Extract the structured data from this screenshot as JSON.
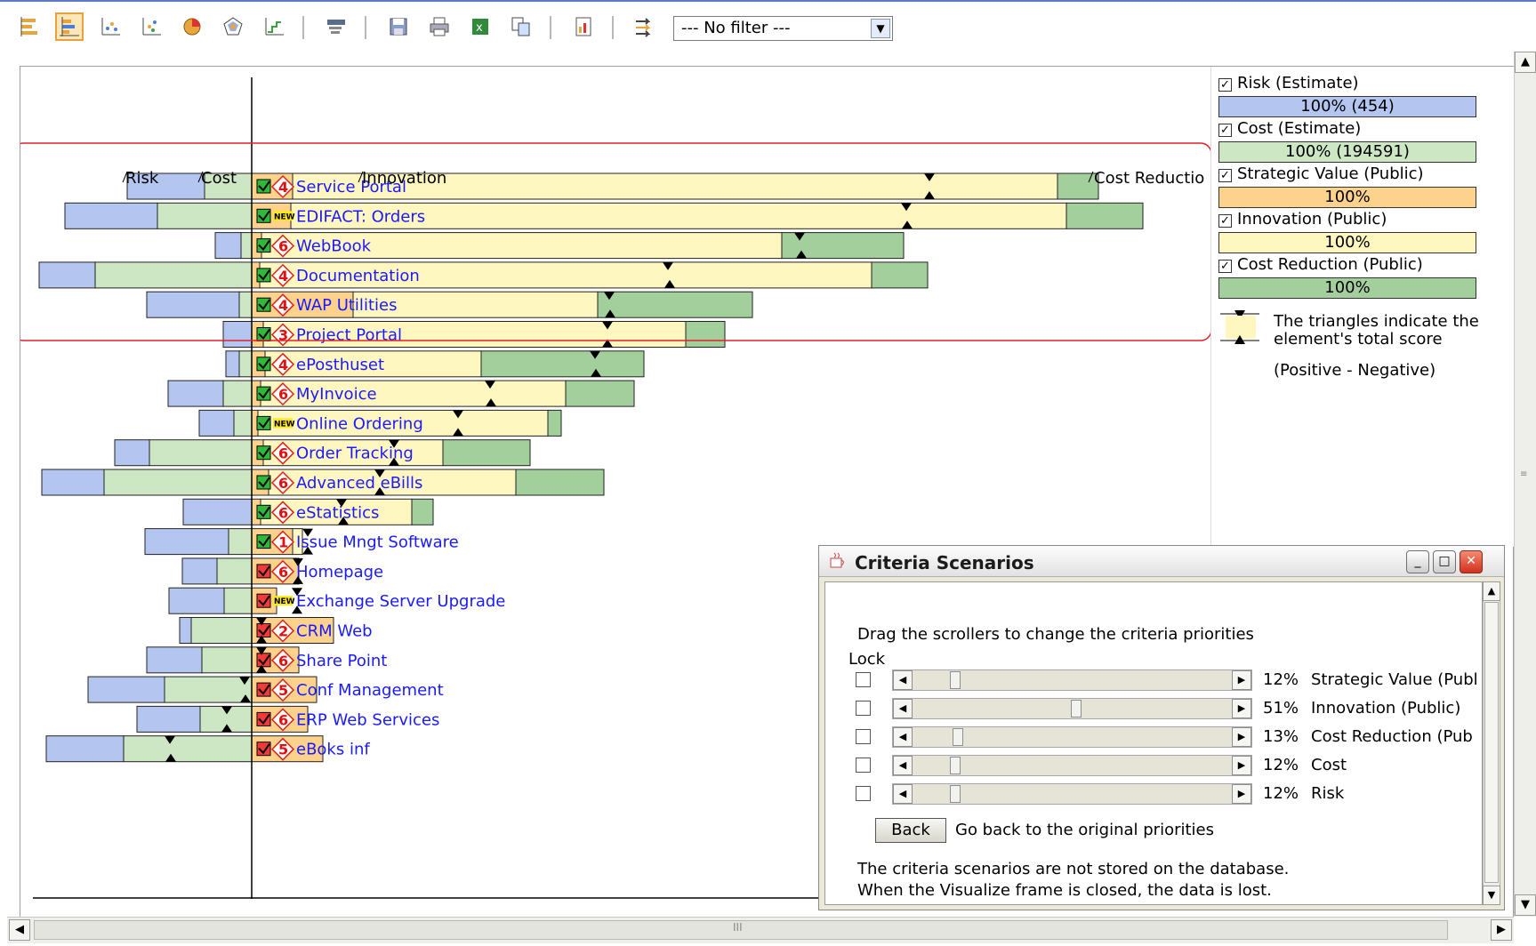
{
  "toolbar": {
    "filter_value": "--- No filter ---",
    "buttons": [
      "gantt-view-icon",
      "bar-view-icon",
      "scatter-view-icon",
      "scatter-alt-icon",
      "pie-view-icon",
      "radar-view-icon",
      "step-chart-icon",
      "filter-settings-icon",
      "save-icon",
      "print-icon",
      "export-excel-icon",
      "copy-icon",
      "report-icon",
      "scenarios-icon"
    ]
  },
  "chart": {
    "column_labels": {
      "risk": "Risk",
      "cost": "Cost",
      "innovation": "Innovation",
      "cost_reduction": "Cost Reductio"
    },
    "colors": {
      "risk": "#b4c6f0",
      "cost": "#cde6c4",
      "strategic": "#fdd28c",
      "innovation": "#fff6c0",
      "cost_reduction": "#a3cf9d",
      "highlight": "#e0202a",
      "link": "#1a1aff",
      "axis": "#000000"
    }
  },
  "chart_data": {
    "type": "bar",
    "categories": [
      "Service Portal",
      "EDIFACT: Orders",
      "WebBook",
      "Documentation",
      "WAP Utilities",
      "Project Portal",
      "ePosthuset",
      "MyInvoice",
      "Online Ordering",
      "Order Tracking",
      "Advanced eBills",
      "eStatistics",
      "Issue Mngt Software",
      "Homepage",
      "Exchange Server Upgrade",
      "CRM Web",
      "Share Point",
      "Conf Management",
      "ERP Web Services",
      "eBoks inf"
    ],
    "badges": [
      "4",
      "NEW",
      "6",
      "4",
      "4",
      "3",
      "4",
      "6",
      "NEW",
      "6",
      "6",
      "6",
      "1",
      "6",
      "NEW",
      "2",
      "6",
      "5",
      "6",
      "5"
    ],
    "status": [
      "green",
      "green",
      "green",
      "green",
      "green",
      "green",
      "green",
      "green",
      "green",
      "green",
      "green",
      "green",
      "green",
      "red",
      "red",
      "red",
      "red",
      "red",
      "red",
      "red"
    ],
    "series": [
      {
        "name": "Risk",
        "values": [
          87,
          104,
          29,
          63,
          104,
          32,
          15,
          62,
          39,
          39,
          70,
          77,
          94,
          39,
          62,
          13,
          62,
          86,
          71,
          87
        ]
      },
      {
        "name": "Cost",
        "values": [
          53,
          106,
          12,
          176,
          14,
          0,
          14,
          32,
          20,
          115,
          166,
          0,
          26,
          39,
          31,
          68,
          56,
          98,
          58,
          144
        ]
      },
      {
        "name": "Strategic Value",
        "values": [
          46,
          44,
          11,
          9,
          114,
          13,
          15,
          10,
          7,
          13,
          19,
          10,
          46,
          53,
          28,
          92,
          53,
          73,
          63,
          80
        ]
      },
      {
        "name": "Innovation",
        "values": [
          860,
          872,
          585,
          688,
          275,
          475,
          243,
          343,
          326,
          202,
          278,
          170,
          11,
          0,
          0,
          0,
          0,
          0,
          0,
          0
        ]
      },
      {
        "name": "Cost Reduction",
        "values": [
          46,
          86,
          137,
          63,
          174,
          44,
          183,
          77,
          15,
          98,
          99,
          24,
          0,
          0,
          0,
          0,
          0,
          0,
          0,
          0
        ]
      }
    ],
    "score_negative": [
      1022,
      996,
      876,
      728,
      662,
      660,
      646,
      528,
      492,
      420,
      404,
      361,
      323,
      312,
      311,
      271,
      271,
      252,
      232,
      168
    ],
    "score_positive": [
      1022,
      997,
      878,
      730,
      663,
      660,
      647,
      529,
      492,
      420,
      404,
      363,
      323,
      312,
      311,
      271,
      271,
      253,
      232,
      169
    ]
  },
  "legend": {
    "items": [
      {
        "label": "Risk (Estimate)",
        "bar": "100% (454)",
        "color": "#b4c6f0"
      },
      {
        "label": "Cost (Estimate)",
        "bar": "100% (194591)",
        "color": "#cde6c4"
      },
      {
        "label": "Strategic Value (Public)",
        "bar": "100%",
        "color": "#fdd28c"
      },
      {
        "label": "Innovation (Public)",
        "bar": "100%",
        "color": "#fff6c0"
      },
      {
        "label": "Cost Reduction (Public)",
        "bar": "100%",
        "color": "#a3cf9d"
      }
    ],
    "triangle_note_1": "The triangles indicate the",
    "triangle_note_2": "element's total score",
    "triangle_note_3": "(Positive - Negative)"
  },
  "dialog": {
    "title": "Criteria Scenarios",
    "instruction": "Drag the scrollers to change the criteria priorities",
    "lock_label": "Lock",
    "criteria": [
      {
        "percent": "12%",
        "label": "Strategic Value (Publ",
        "value": 0.12
      },
      {
        "percent": "51%",
        "label": "Innovation (Public)",
        "value": 0.51
      },
      {
        "percent": "13%",
        "label": "Cost Reduction (Pub",
        "value": 0.13
      },
      {
        "percent": "12%",
        "label": "Cost",
        "value": 0.12
      },
      {
        "percent": "12%",
        "label": "Risk",
        "value": 0.12
      }
    ],
    "back_label": "Back",
    "back_text": "Go back to the original priorities",
    "note_1": "The criteria scenarios are not stored on the database.",
    "note_2": "When the Visualize frame is closed, the data is lost."
  }
}
